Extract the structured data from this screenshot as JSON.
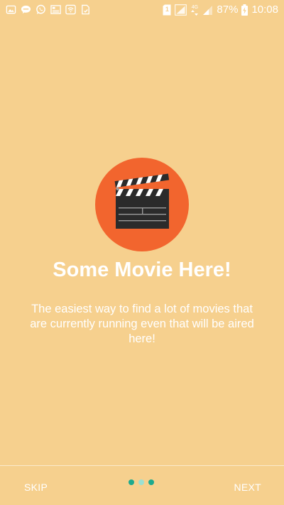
{
  "status_bar": {
    "notification_icons": [
      "gallery-icon",
      "chat-icon",
      "whatsapp-icon",
      "photo-icon",
      "wifi-box-icon",
      "document-icon"
    ],
    "sim_label": "1",
    "network_label": "4G",
    "battery_percent": "87%",
    "time": "10:08"
  },
  "onboarding": {
    "title": "Some Movie Here!",
    "description": "The easiest way to find a lot of movies that are currently running even that will be aired here!",
    "illustration": "clapperboard-icon",
    "colors": {
      "background": "#F6D08E",
      "circle": "#F2652E",
      "dot_inactive": "#1DAA8E",
      "dot_active": "#9BE0D2"
    }
  },
  "bottom_nav": {
    "skip_label": "SKIP",
    "next_label": "NEXT",
    "page_count": 3,
    "current_page": 2
  }
}
